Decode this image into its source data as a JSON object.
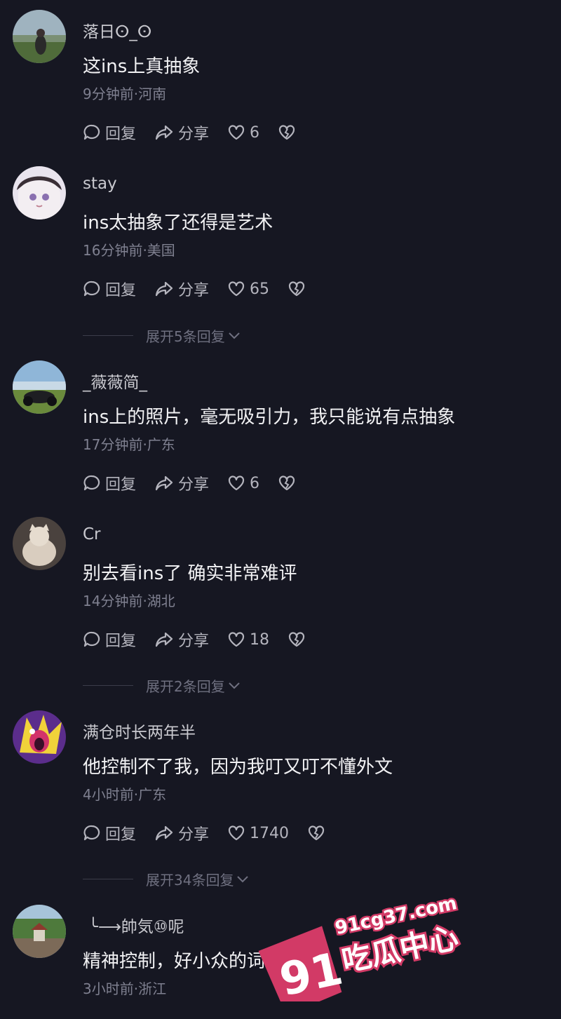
{
  "comments": [
    {
      "username": "落日ⵙ_ⵙ",
      "content": "这ins上真抽象",
      "meta": "9分钟前·河南",
      "reply_label": "回复",
      "share_label": "分享",
      "likes": "6"
    },
    {
      "username": "stay",
      "content": "ins太抽象了还得是艺术",
      "meta": "16分钟前·美国",
      "reply_label": "回复",
      "share_label": "分享",
      "likes": "65",
      "expand": "展开5条回复"
    },
    {
      "username": "_薇薇简_",
      "content": "ins上的照片，毫无吸引力，我只能说有点抽象",
      "meta": "17分钟前·广东",
      "reply_label": "回复",
      "share_label": "分享",
      "likes": "6"
    },
    {
      "username": "Cr",
      "content": "别去看ins了 确实非常难评",
      "meta": "14分钟前·湖北",
      "reply_label": "回复",
      "share_label": "分享",
      "likes": "18",
      "expand": "展开2条回复"
    },
    {
      "username": "满仓时长两年半",
      "content": "他控制不了我，因为我叮又叮不懂外文",
      "meta": "4小时前·广东",
      "reply_label": "回复",
      "share_label": "分享",
      "likes": "1740",
      "expand": "展开34条回复"
    },
    {
      "username": "╰⟶帥気⑩呢",
      "content": "精神控制，好小众的词",
      "meta": "3小时前·浙江"
    }
  ],
  "watermark": {
    "site": "91cg37.com",
    "number": "91",
    "name": "吃瓜中心"
  },
  "icons": {
    "reply": "reply-bubble-icon",
    "share": "share-arrow-icon",
    "like": "heart-icon",
    "dislike": "broken-heart-icon",
    "expand": "chevron-down-icon"
  },
  "colors": {
    "background": "#161722",
    "watermark_pink": "#d23a66"
  }
}
